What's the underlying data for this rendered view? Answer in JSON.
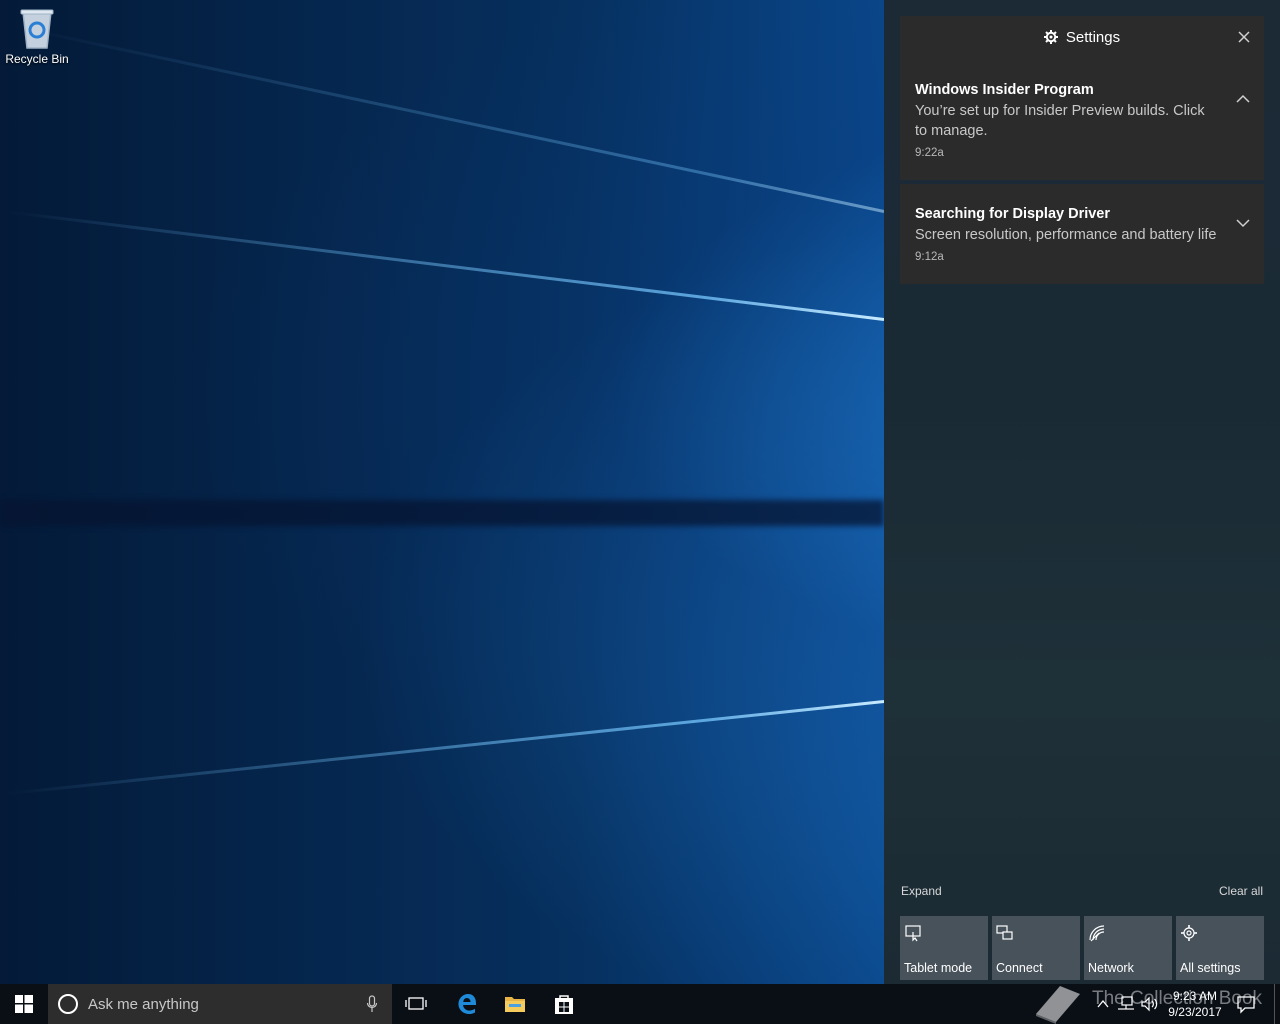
{
  "desktop": {
    "icons": [
      {
        "label": "Recycle Bin",
        "icon": "recycle-bin-icon"
      }
    ]
  },
  "action_center": {
    "header": {
      "title": "Settings",
      "icon": "gear-icon",
      "close_icon": "close-icon"
    },
    "notifications": [
      {
        "title": "Windows Insider Program",
        "body": "You’re set up for Insider Preview builds. Click to manage.",
        "time": "9:22a",
        "chevron": "chevron-up-icon"
      },
      {
        "title": "Searching for Display Driver",
        "body": "Screen resolution, performance and battery life",
        "time": "9:12a",
        "chevron": "chevron-down-icon"
      }
    ],
    "expand_label": "Expand",
    "clear_all_label": "Clear all",
    "quick_actions": [
      {
        "label": "Tablet mode",
        "icon": "tablet-mode-icon"
      },
      {
        "label": "Connect",
        "icon": "connect-icon"
      },
      {
        "label": "Network",
        "icon": "network-icon"
      },
      {
        "label": "All settings",
        "icon": "settings-gear-icon"
      }
    ]
  },
  "taskbar": {
    "search_placeholder": "Ask me anything",
    "pinned": [
      "task-view-icon",
      "edge-icon",
      "file-explorer-icon",
      "store-icon"
    ],
    "watermark": "The Collection Book",
    "time": "9:23 AM",
    "date": "9/23/2017"
  },
  "colors": {
    "accent_blue": "#0c5cb0",
    "panel_dark": "#2b2b2b",
    "tile_gray": "#48525b",
    "taskbar": "#0a0f16"
  }
}
